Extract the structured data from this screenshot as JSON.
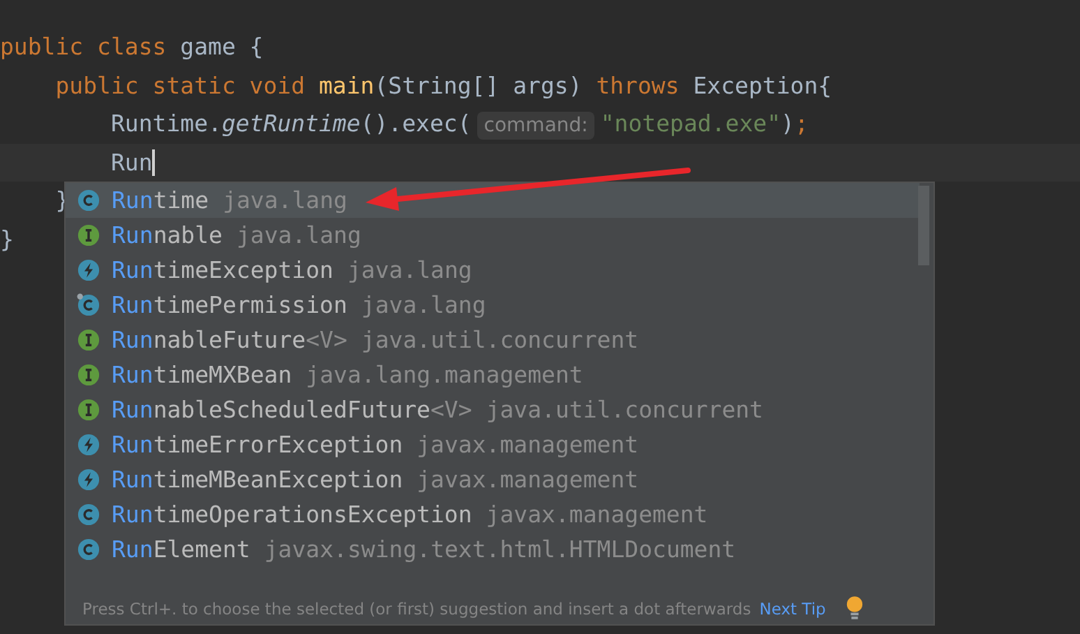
{
  "editor": {
    "lines": [
      {
        "tokens": [
          {
            "kind": "keyword",
            "text": "public class "
          },
          {
            "kind": "plain",
            "text": "game {"
          }
        ]
      },
      {
        "tokens": [
          {
            "kind": "keyword",
            "text": "    public static void "
          },
          {
            "kind": "declaration",
            "text": "main"
          },
          {
            "kind": "plain",
            "text": "(String[] args) "
          },
          {
            "kind": "keyword",
            "text": "throws "
          },
          {
            "kind": "plain",
            "text": "Exception{"
          }
        ]
      },
      {
        "tokens": [
          {
            "kind": "plain",
            "text": "        Runtime."
          },
          {
            "kind": "italic",
            "text": "getRuntime"
          },
          {
            "kind": "plain",
            "text": "().exec("
          },
          {
            "kind": "hint",
            "text": "command:"
          },
          {
            "kind": "string",
            "text": "\"notepad.exe\""
          },
          {
            "kind": "plain",
            "text": ")"
          },
          {
            "kind": "keyword",
            "text": ";"
          }
        ]
      },
      {
        "current": true,
        "caret": true,
        "tokens": [
          {
            "kind": "plain",
            "text": "        Run"
          }
        ]
      },
      {
        "tokens": [
          {
            "kind": "plain",
            "text": "    }"
          }
        ]
      },
      {
        "tokens": [
          {
            "kind": "plain",
            "text": "}"
          }
        ]
      }
    ]
  },
  "popup": {
    "suggestions": [
      {
        "kind": "class",
        "match": "Run",
        "rest": "time",
        "package": "java.lang",
        "selected": true
      },
      {
        "kind": "interface",
        "match": "Run",
        "rest": "nable",
        "package": "java.lang",
        "selected": false
      },
      {
        "kind": "exception",
        "match": "Run",
        "rest": "timeException",
        "package": "java.lang",
        "selected": false
      },
      {
        "kind": "pinned_class",
        "match": "Run",
        "rest": "timePermission",
        "package": "java.lang",
        "selected": false
      },
      {
        "kind": "interface",
        "match": "Run",
        "rest": "nableFuture",
        "type_param": "<V>",
        "package": "java.util.concurrent",
        "selected": false
      },
      {
        "kind": "interface",
        "match": "Run",
        "rest": "timeMXBean",
        "package": "java.lang.management",
        "selected": false
      },
      {
        "kind": "interface",
        "match": "Run",
        "rest": "nableScheduledFuture",
        "type_param": "<V>",
        "package": "java.util.concurrent",
        "selected": false
      },
      {
        "kind": "exception",
        "match": "Run",
        "rest": "timeErrorException",
        "package": "javax.management",
        "selected": false
      },
      {
        "kind": "exception",
        "match": "Run",
        "rest": "timeMBeanException",
        "package": "javax.management",
        "selected": false
      },
      {
        "kind": "class",
        "match": "Run",
        "rest": "timeOperationsException",
        "package": "javax.management",
        "selected": false
      },
      {
        "kind": "class",
        "match": "Run",
        "rest": "Element",
        "package": "javax.swing.text.html.HTMLDocument",
        "selected": false
      }
    ],
    "footer": {
      "tip": "Press Ctrl+. to choose the selected (or first) suggestion and insert a dot afterwards",
      "link": "Next Tip"
    }
  }
}
